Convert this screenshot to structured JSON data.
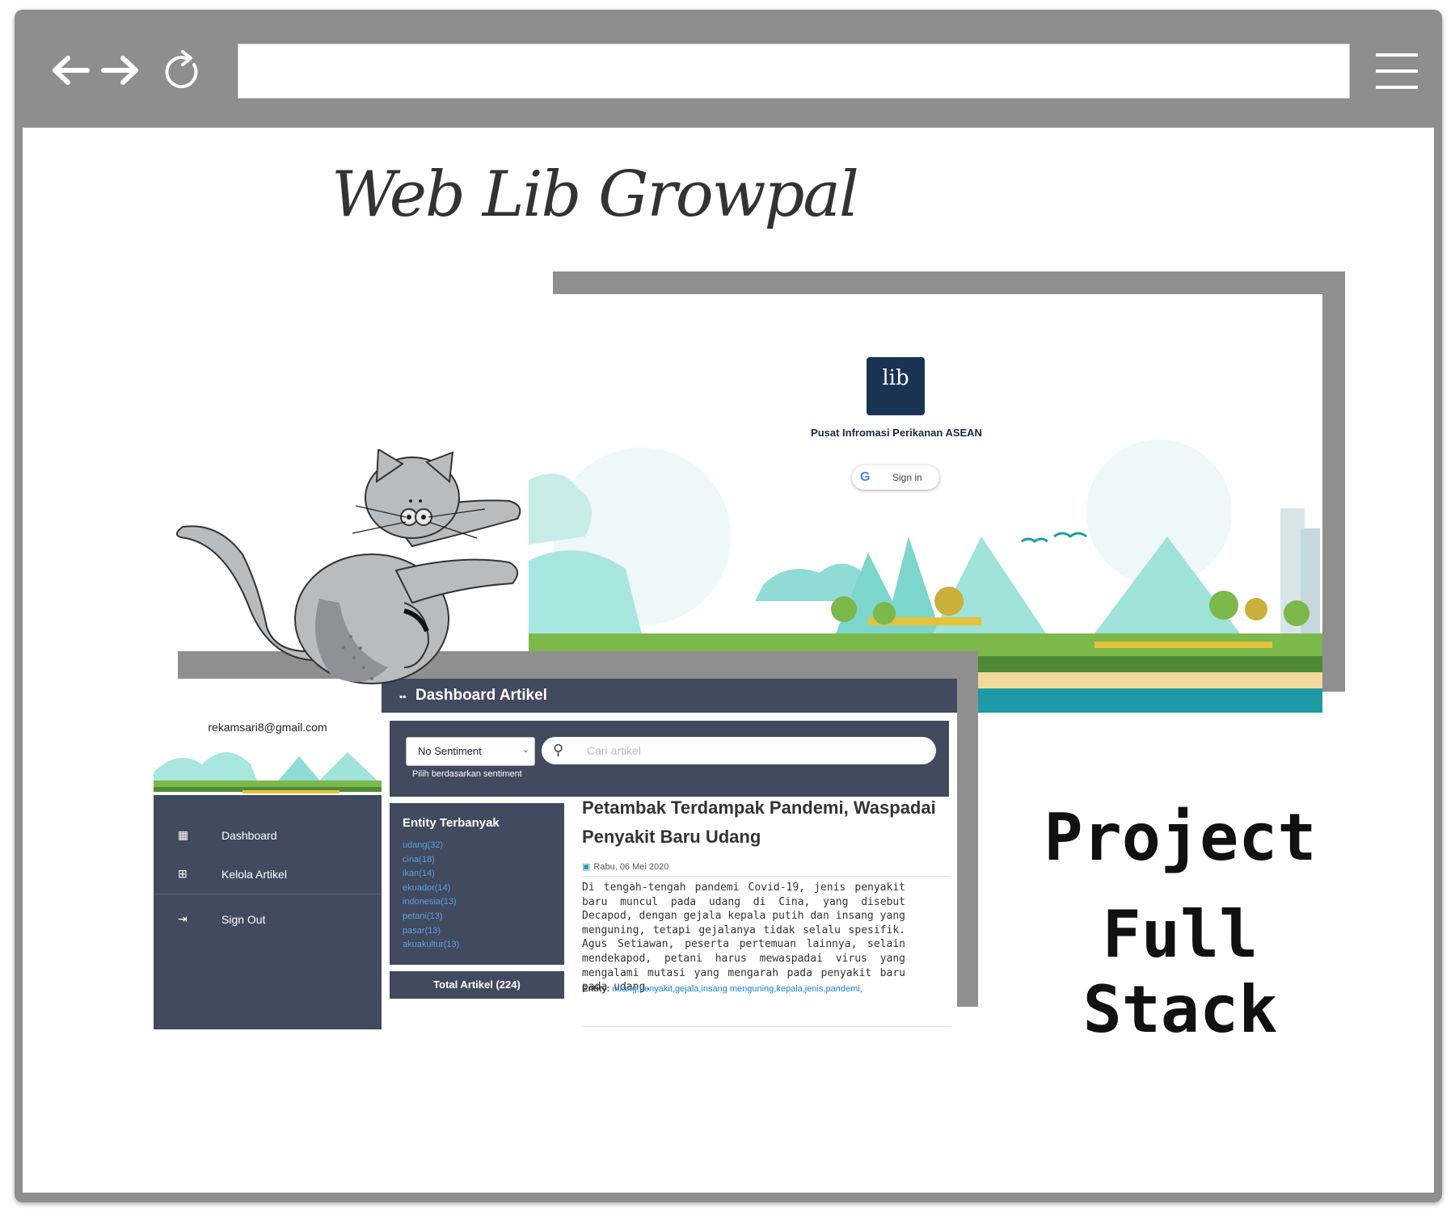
{
  "browser": {
    "back_icon": "arrow-left-icon",
    "forward_icon": "arrow-right-icon",
    "reload_icon": "reload-icon",
    "menu_icon": "hamburger-menu-icon",
    "address_value": ""
  },
  "hero": {
    "title": "Web Lib Growpal",
    "project_line1": "Project",
    "project_line2": "Full Stack"
  },
  "login": {
    "logo_text": "lib",
    "org_name": "Pusat Infromasi Perikanan ASEAN",
    "signin_label": "Sign in",
    "google_icon": "G"
  },
  "dashboard": {
    "user_email": "rekamsari8@gmail.com",
    "header_title": "Dashboard Artikel",
    "sidebar": [
      {
        "label": "Dashboard",
        "icon": "dashboard-icon"
      },
      {
        "label": "Kelola Artikel",
        "icon": "add-article-icon"
      },
      {
        "label": "Sign Out",
        "icon": "sign-out-icon"
      }
    ],
    "sentiment_select": {
      "value": "No Sentiment",
      "hint": "Pilih berdasarkan sentiment"
    },
    "search": {
      "placeholder": "Cari artikel",
      "value": ""
    },
    "entity_box": {
      "title": "Entity Terbanyak",
      "items": [
        "udang(32)",
        "cina(18)",
        "ikan(14)",
        "ekuador(14)",
        "indonesia(13)",
        "petani(13)",
        "pasar(13)",
        "akuakultur(13)"
      ]
    },
    "total_label": "Total Artikel (224)",
    "article": {
      "title": "Petambak Terdampak Pandemi, Waspadai Penyakit Baru Udang",
      "date": "Rabu, 06 Mei 2020",
      "body": "Di tengah-tengah pandemi Covid-19, jenis penyakit baru muncul pada udang di Cina, yang disebut Decapod, dengan gejala kepala putih dan insang yang menguning, tetapi gejalanya tidak selalu spesifik. Agus Setiawan, peserta pertemuan lainnya, selain mendekapod, petani harus mewaspadai virus yang mengalami mutasi yang mengarah pada penyakit baru pada udang.",
      "entity_label": "Entity:",
      "entities": "udang,penyakit,gejala,insang menguning,kepala,jenis,pandemi,"
    }
  },
  "colors": {
    "browser_chrome": "#8e8e8e",
    "dashboard_navy": "#414a5e",
    "logo_navy": "#1a3352",
    "link_blue": "#1a7fd6",
    "teal": "#1e9aa6"
  }
}
